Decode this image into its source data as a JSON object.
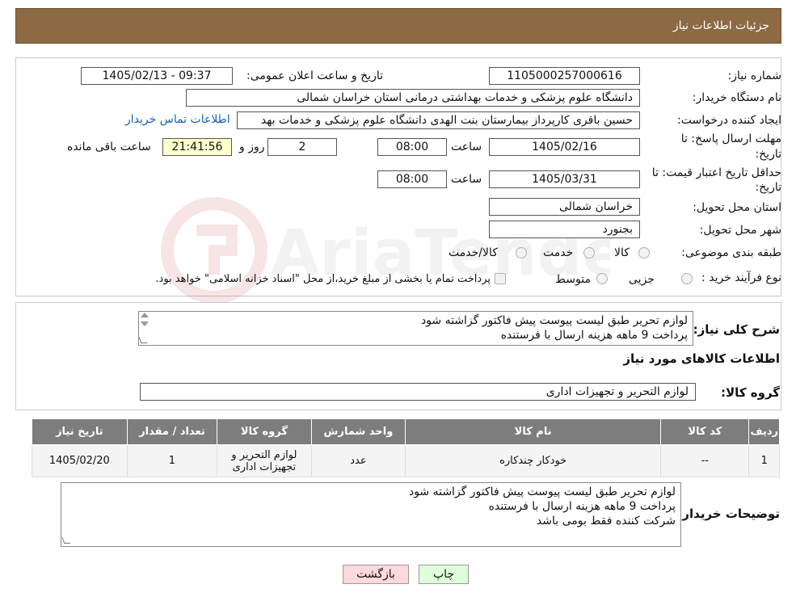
{
  "header": {
    "title": "جزئیات اطلاعات نیاز"
  },
  "form": {
    "need_number_label": "شماره نیاز:",
    "need_number": "1105000257000616",
    "announce_label": "تاریخ و ساعت اعلان عمومی:",
    "announce_value": "1405/02/13 - 09:37",
    "buyer_org_label": "نام دستگاه خریدار:",
    "buyer_org": "دانشگاه علوم پزشکی و خدمات بهداشتی درمانی استان خراسان شمالی",
    "creator_label": "ایجاد کننده درخواست:",
    "creator": "حسین باقری کارپرداز بیمارستان بنت الهدی دانشگاه علوم پزشکی و خدمات بهد",
    "contact_link": "اطلاعات تماس خریدار",
    "deadline_label_1": "مهلت ارسال پاسخ: تا",
    "deadline_label_2": "تاریخ:",
    "deadline_date": "1405/02/16",
    "time_label": "ساعت",
    "deadline_time": "08:00",
    "days_value": "2",
    "days_label": "روز و",
    "remaining_time": "21:41:56",
    "remaining_label": "ساعت باقی مانده",
    "validity_label_1": "حداقل تاریخ اعتبار قیمت: تا",
    "validity_label_2": "تاریخ:",
    "validity_date": "1405/03/31",
    "validity_time": "08:00",
    "province_label": "استان محل تحویل:",
    "province": "خراسان شمالی",
    "city_label": "شهر محل تحویل:",
    "city": "بجنورد",
    "category_label": "طبقه بندی موضوعی:",
    "category_options": [
      "کالا",
      "خدمت",
      "کالا/خدمت"
    ],
    "process_label": "نوع فرآیند خرید :",
    "process_options": [
      "جزیی",
      "متوسط"
    ],
    "process_note": "پرداخت تمام یا بخشی از مبلغ خرید،از محل \"اسناد خزانه اسلامی\" خواهد بود."
  },
  "description": {
    "label": "شرح کلی نیاز:",
    "lines": [
      "لوازم تحریر طبق لیست پیوست پیش فاکتور گزاشته شود",
      "پرداخت 9 ماهه هزینه ارسال با فرستنده"
    ]
  },
  "goods": {
    "section_title": "اطلاعات کالاهای مورد نیاز",
    "group_label": "گروه کالا:",
    "group_value": "لوازم التحریر و تجهیزات اداری"
  },
  "table": {
    "headers": [
      "ردیف",
      "کد کالا",
      "نام کالا",
      "واحد شمارش",
      "گروه کالا",
      "تعداد / مقدار",
      "تاریخ نیاز"
    ],
    "rows": [
      {
        "row": "1",
        "code": "--",
        "name": "خودکار چندکاره",
        "unit": "عدد",
        "group_line1": "لوازم التحریر و",
        "group_line2": "تجهیزات اداری",
        "qty": "1",
        "date": "1405/02/20"
      }
    ]
  },
  "buyer_notes": {
    "label": "توضیحات خریدار:",
    "lines": [
      "لوازم تحریر طبق لیست پیوست پیش فاکتور گزاشته شود",
      "پرداخت 9 ماهه هزینه ارسال با فرستنده",
      "شرکت کننده فقط بومی باشد"
    ]
  },
  "buttons": {
    "print": "چاپ",
    "back": "بازگشت"
  },
  "watermark": {
    "text": "AriaTender.neT"
  },
  "colors": {
    "header": "#8b6a44",
    "table_header": "#7d7d7d",
    "link": "#1a5fb4",
    "back_button": "#ffd9dc",
    "print_button": "#ddffd9"
  }
}
